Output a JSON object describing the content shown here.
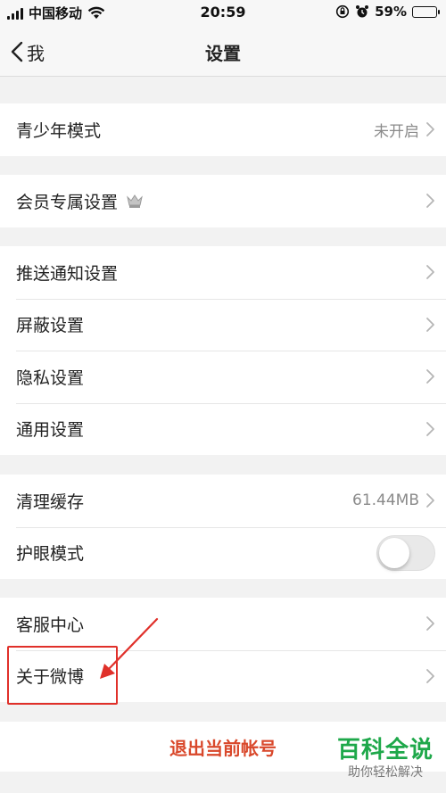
{
  "status_bar": {
    "carrier": "中国移动",
    "time": "20:59",
    "battery": "59%",
    "battery_level": 0.59
  },
  "nav": {
    "back_label": "我",
    "title": "设置"
  },
  "groups": [
    {
      "items": [
        {
          "label": "青少年模式",
          "value": "未开启",
          "chevron": true
        }
      ]
    },
    {
      "items": [
        {
          "label": "会员专属设置",
          "icon": "crown-icon",
          "chevron": true
        }
      ]
    },
    {
      "items": [
        {
          "label": "推送通知设置",
          "chevron": true
        },
        {
          "label": "屏蔽设置",
          "chevron": true
        },
        {
          "label": "隐私设置",
          "chevron": true
        },
        {
          "label": "通用设置",
          "chevron": true
        }
      ]
    },
    {
      "items": [
        {
          "label": "清理缓存",
          "value": "61.44MB",
          "chevron": true
        },
        {
          "label": "护眼模式",
          "toggle": false
        }
      ]
    },
    {
      "items": [
        {
          "label": "客服中心",
          "chevron": true
        },
        {
          "label": "关于微博",
          "chevron": true
        }
      ]
    }
  ],
  "logout_label": "退出当前帐号",
  "watermark": {
    "title": "百科全说",
    "subtitle": "助你轻松解决"
  },
  "colors": {
    "accent_red": "#d9482b",
    "annotation_red": "#e0302a",
    "watermark_green": "#1ea84a",
    "background": "#f2f2f2"
  }
}
